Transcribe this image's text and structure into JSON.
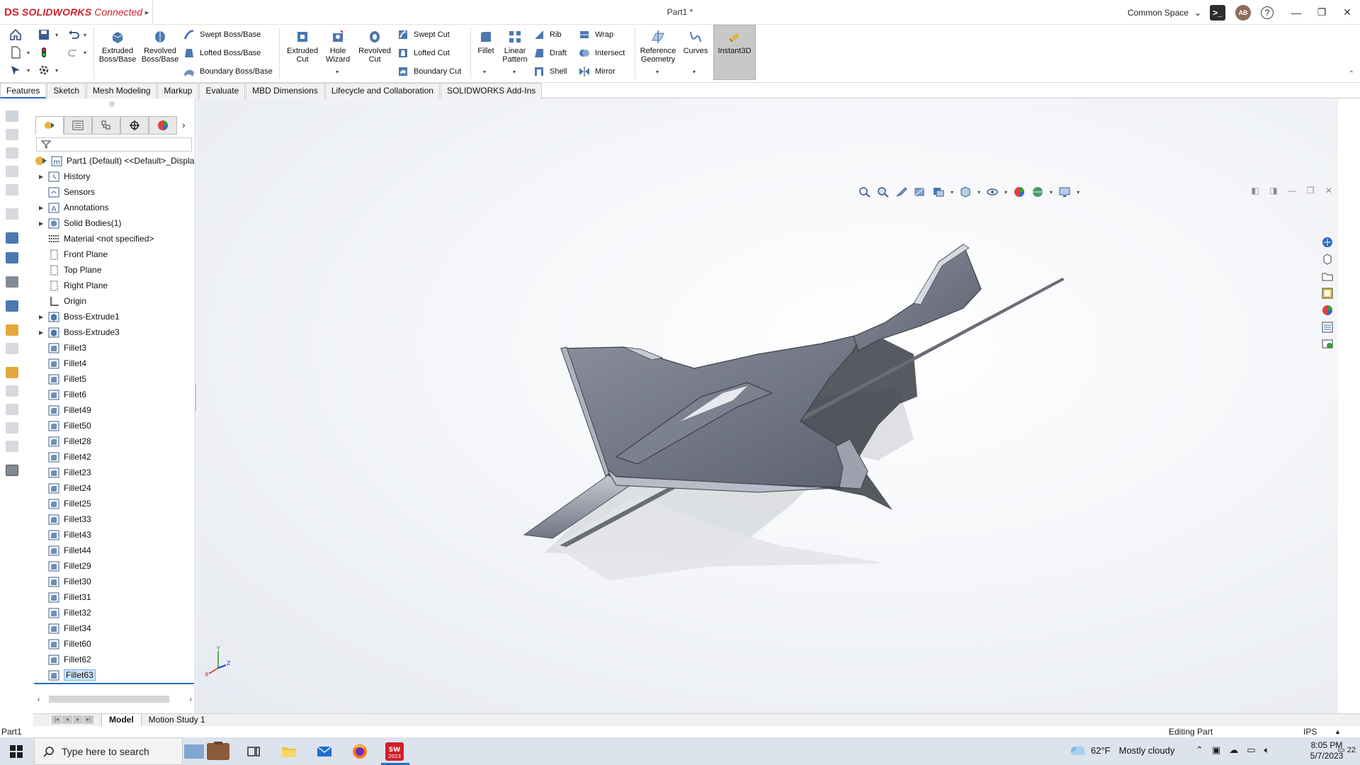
{
  "app": {
    "brand_prefix": "DS",
    "brand_name": "SOLIDWORKS",
    "brand_suffix": "Connected",
    "document_title": "Part1 *",
    "workspace": "Common Space",
    "avatar_initials": "AB"
  },
  "ribbon": {
    "extruded_boss": "Extruded Boss/Base",
    "revolved_boss": "Revolved Boss/Base",
    "swept_boss": "Swept Boss/Base",
    "lofted_boss": "Lofted Boss/Base",
    "boundary_boss": "Boundary Boss/Base",
    "extruded_cut": "Extruded Cut",
    "hole_wizard": "Hole Wizard",
    "revolved_cut": "Revolved Cut",
    "swept_cut": "Swept Cut",
    "lofted_cut": "Lofted Cut",
    "boundary_cut": "Boundary Cut",
    "fillet": "Fillet",
    "linear_pattern": "Linear Pattern",
    "rib": "Rib",
    "draft": "Draft",
    "shell": "Shell",
    "wrap": "Wrap",
    "intersect": "Intersect",
    "mirror": "Mirror",
    "reference_geometry": "Reference Geometry",
    "curves": "Curves",
    "instant3d": "Instant3D"
  },
  "tabs": [
    "Features",
    "Sketch",
    "Mesh Modeling",
    "Markup",
    "Evaluate",
    "MBD Dimensions",
    "Lifecycle and Collaboration",
    "SOLIDWORKS Add-Ins"
  ],
  "tree": {
    "root": "Part1 (Default) <<Default>_Displa",
    "items": [
      {
        "label": "History",
        "expandable": true,
        "icon": "history"
      },
      {
        "label": "Sensors",
        "expandable": false,
        "icon": "sensor"
      },
      {
        "label": "Annotations",
        "expandable": true,
        "icon": "annotation"
      },
      {
        "label": "Solid Bodies(1)",
        "expandable": true,
        "icon": "solid"
      },
      {
        "label": "Material <not specified>",
        "expandable": false,
        "icon": "material"
      },
      {
        "label": "Front Plane",
        "expandable": false,
        "icon": "plane"
      },
      {
        "label": "Top Plane",
        "expandable": false,
        "icon": "plane"
      },
      {
        "label": "Right Plane",
        "expandable": false,
        "icon": "plane"
      },
      {
        "label": "Origin",
        "expandable": false,
        "icon": "origin"
      },
      {
        "label": "Boss-Extrude1",
        "expandable": true,
        "icon": "extrude"
      },
      {
        "label": "Boss-Extrude3",
        "expandable": true,
        "icon": "extrude"
      },
      {
        "label": "Fillet3",
        "expandable": false,
        "icon": "fillet"
      },
      {
        "label": "Fillet4",
        "expandable": false,
        "icon": "fillet"
      },
      {
        "label": "Fillet5",
        "expandable": false,
        "icon": "fillet"
      },
      {
        "label": "Fillet6",
        "expandable": false,
        "icon": "fillet"
      },
      {
        "label": "Fillet49",
        "expandable": false,
        "icon": "fillet"
      },
      {
        "label": "Fillet50",
        "expandable": false,
        "icon": "fillet"
      },
      {
        "label": "Fillet28",
        "expandable": false,
        "icon": "fillet"
      },
      {
        "label": "Fillet42",
        "expandable": false,
        "icon": "fillet"
      },
      {
        "label": "Fillet23",
        "expandable": false,
        "icon": "fillet"
      },
      {
        "label": "Fillet24",
        "expandable": false,
        "icon": "fillet"
      },
      {
        "label": "Fillet25",
        "expandable": false,
        "icon": "fillet"
      },
      {
        "label": "Fillet33",
        "expandable": false,
        "icon": "fillet"
      },
      {
        "label": "Fillet43",
        "expandable": false,
        "icon": "fillet"
      },
      {
        "label": "Fillet44",
        "expandable": false,
        "icon": "fillet"
      },
      {
        "label": "Fillet29",
        "expandable": false,
        "icon": "fillet"
      },
      {
        "label": "Fillet30",
        "expandable": false,
        "icon": "fillet"
      },
      {
        "label": "Fillet31",
        "expandable": false,
        "icon": "fillet"
      },
      {
        "label": "Fillet32",
        "expandable": false,
        "icon": "fillet"
      },
      {
        "label": "Fillet34",
        "expandable": false,
        "icon": "fillet"
      },
      {
        "label": "Fillet60",
        "expandable": false,
        "icon": "fillet"
      },
      {
        "label": "Fillet62",
        "expandable": false,
        "icon": "fillet"
      },
      {
        "label": "Fillet63",
        "expandable": false,
        "icon": "fillet",
        "selected": true
      }
    ]
  },
  "bottom_tabs": [
    "Model",
    "Motion Study 1"
  ],
  "status": {
    "left": "Part1",
    "mode": "Editing Part",
    "units": "IPS"
  },
  "taskbar": {
    "search_placeholder": "Type here to search",
    "weather_temp": "62°F",
    "weather_desc": "Mostly cloudy",
    "time": "8:05 PM",
    "date": "5/7/2023",
    "notifications": "22"
  },
  "colors": {
    "brand_red": "#d0202a",
    "accent_blue": "#2a6bc0",
    "model_gray": "#6f7480"
  }
}
